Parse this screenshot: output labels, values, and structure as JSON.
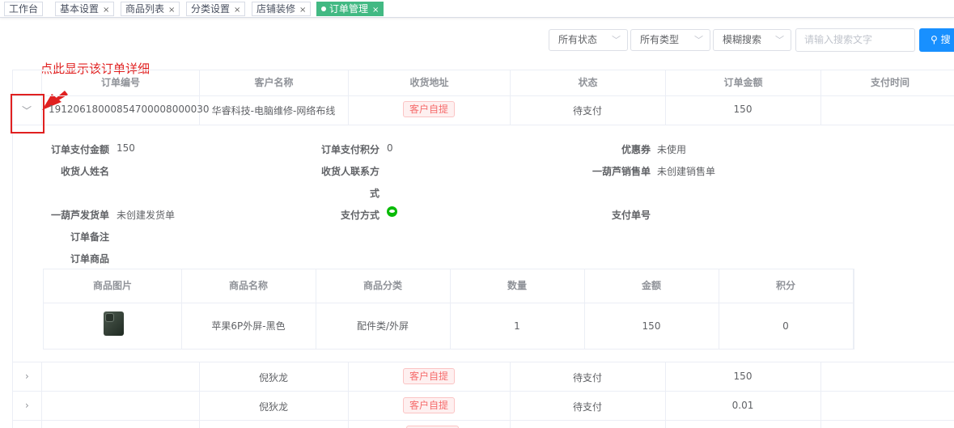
{
  "tabs": [
    {
      "label": "工作台",
      "closable": false
    },
    {
      "label": "基本设置",
      "closable": true
    },
    {
      "label": "商品列表",
      "closable": true
    },
    {
      "label": "分类设置",
      "closable": true
    },
    {
      "label": "店铺装修",
      "closable": true
    },
    {
      "label": "订单管理",
      "closable": true,
      "active": true
    }
  ],
  "filters": {
    "status": "所有状态",
    "type": "所有类型",
    "mode": "模糊搜索",
    "search_placeholder": "请输入搜索文字",
    "search_button": "搜"
  },
  "annotation": "点此显示该订单详细",
  "table": {
    "columns": [
      "订单编号",
      "客户名称",
      "收货地址",
      "状态",
      "订单金额",
      "支付时间"
    ],
    "rows": [
      {
        "order_no": "19120618000854700008000030",
        "customer": "华睿科技-电脑维修-网络布线",
        "address": "客户自提",
        "status": "待支付",
        "amount": "150",
        "paid_at": "",
        "expanded": true
      },
      {
        "order_no": "",
        "customer": "倪狄龙",
        "address": "客户自提",
        "status": "待支付",
        "amount": "150",
        "paid_at": ""
      },
      {
        "order_no": "",
        "customer": "倪狄龙",
        "address": "客户自提",
        "status": "待支付",
        "amount": "0.01",
        "paid_at": ""
      }
    ]
  },
  "detail": {
    "pay_amount_label": "订单支付金额",
    "pay_amount": "150",
    "pay_points_label": "订单支付积分",
    "pay_points": "0",
    "coupon_label": "优惠券",
    "coupon": "未使用",
    "receiver_name_label": "收货人姓名",
    "receiver_phone_label_1": "收货人联系方",
    "receiver_phone_label_2": "式",
    "sales_order_label": "一葫芦销售单",
    "sales_order": "未创建销售单",
    "delivery_label": "一葫芦发货单",
    "delivery": "未创建发货单",
    "pay_method_label": "支付方式",
    "pay_method_icon": "wechat-pay-icon",
    "pay_no_label": "支付单号",
    "remark_label": "订单备注",
    "goods_label": "订单商品"
  },
  "goods_table": {
    "columns": [
      "商品图片",
      "商品名称",
      "商品分类",
      "数量",
      "金额",
      "积分"
    ],
    "rows": [
      {
        "name": "苹果6P外屏-黑色",
        "category": "配件类/外屏",
        "qty": "1",
        "amount": "150",
        "points": "0"
      }
    ]
  },
  "colors": {
    "accent": "#1890ff",
    "active_tab": "#42b983",
    "tag_red": "#f56c6c",
    "annotation": "#e02020"
  }
}
